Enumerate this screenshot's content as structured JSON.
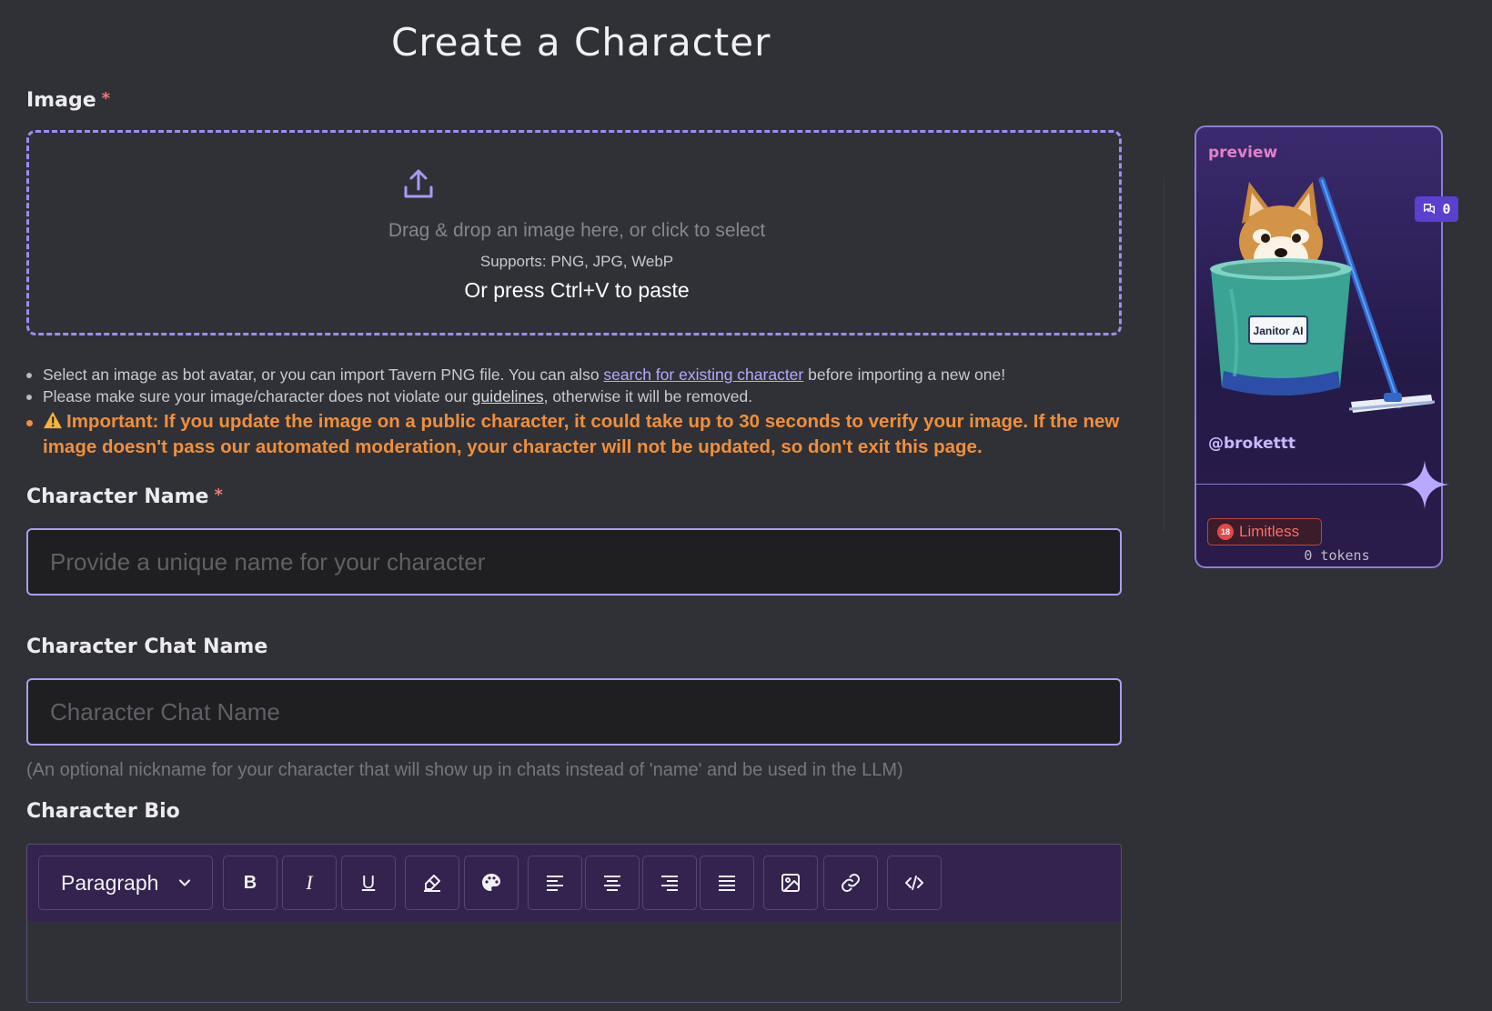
{
  "page": {
    "title": "Create a Character"
  },
  "image_section": {
    "label": "Image",
    "required_mark": "*",
    "dropzone": {
      "main_text": "Drag & drop an image here, or click to select",
      "supports_text": "Supports: PNG, JPG, WebP",
      "paste_text": "Or press Ctrl+V to paste"
    }
  },
  "notes": {
    "note1_prefix": "Select an image as bot avatar, or you can import Tavern PNG file. You can also ",
    "note1_link": "search for existing character",
    "note1_suffix": " before importing a new one!",
    "note2_prefix": "Please make sure your image/character does not violate our ",
    "note2_link": "guidelines",
    "note2_suffix": ", otherwise it will be removed.",
    "important_label": "Important:",
    "important_text": " If you update the image on a public character, it could take up to 30 seconds to verify your image. If the new image doesn't pass our automated moderation, your character will not be updated, so don't exit this page."
  },
  "character_name": {
    "label": "Character Name",
    "required_mark": "*",
    "placeholder": "Provide a unique name for your character"
  },
  "chat_name": {
    "label": "Character Chat Name",
    "placeholder": "Character Chat Name",
    "hint": "(An optional nickname for your character that will show up in chats instead of 'name' and be used in the LLM)"
  },
  "bio": {
    "label": "Character Bio",
    "toolbar": {
      "block_format": "Paragraph",
      "bold": "B",
      "italic": "I",
      "underline": "U"
    }
  },
  "preview_card": {
    "label": "preview",
    "chat_count": "0",
    "handle": "@brokettt",
    "bucket_text": "Janitor AI",
    "badge": "Limitless",
    "age_mark": "18",
    "tokens": "0 tokens"
  },
  "colors": {
    "accent": "#9d8cf0",
    "warning": "#f08f3c",
    "background": "#303136",
    "toolbar": "#33234e"
  }
}
